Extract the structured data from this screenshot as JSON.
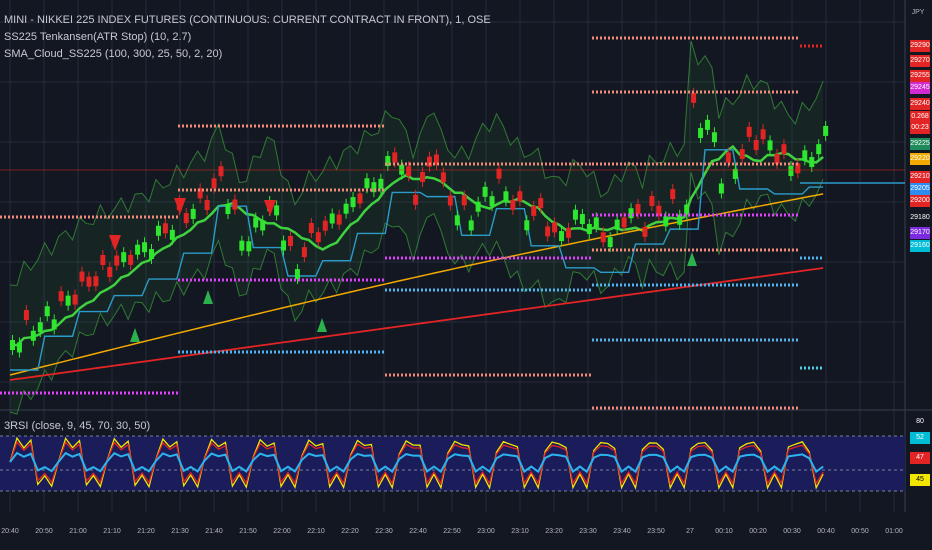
{
  "colors": {
    "background": "#131722",
    "grid": "#262b3e",
    "bull": "#2ee62e",
    "bear": "#e32424",
    "rsi_fill": "#1b1d5a",
    "ma_green": "#3fd13f",
    "ma_orange": "#f2a900",
    "ma_red": "#e32424",
    "band": "#2e8b2e"
  },
  "legend": {
    "symbol": "MINI - NIKKEI 225 INDEX FUTURES (CONTINUOUS: CURRENT CONTRACT IN FRONT), 1, OSE",
    "indicator1": "SS225 Tenkansen(ATR Stop) (10, 2.7)",
    "indicator2": "SMA_Cloud_SS225 (100, 300, 25, 50, 2, 20)",
    "indicator3": "3RSI (close, 9, 45, 70, 30, 50)"
  },
  "currency_label": "JPY",
  "price_axis_labels": [
    {
      "text": "29290",
      "color": "#e32424"
    },
    {
      "text": "29270",
      "color": "#e32424"
    },
    {
      "text": "29255",
      "color": "#e32424"
    },
    {
      "text": "29245",
      "color": "#d12ad1"
    },
    {
      "text": "29240",
      "color": "#e32424"
    },
    {
      "text": "0.268",
      "color": "#e32424"
    },
    {
      "text": "00:23",
      "color": "#e32424"
    },
    {
      "text": "29225",
      "color": "#1f8a5a"
    },
    {
      "text": "29220",
      "color": "#f2a900"
    },
    {
      "text": "29210",
      "color": "#e32424"
    },
    {
      "text": "29205",
      "color": "#2d8cf0"
    },
    {
      "text": "29200",
      "color": "#e32424"
    },
    {
      "text": "29180",
      "color": ""
    },
    {
      "text": "29170",
      "color": "#7b2ae0"
    },
    {
      "text": "29160",
      "color": "#00bcd4"
    }
  ],
  "rsi_axis_labels": [
    {
      "text": "80",
      "color": ""
    },
    {
      "text": "52",
      "color": "#00bcd4"
    },
    {
      "text": "47",
      "color": "#e32424"
    },
    {
      "text": "45",
      "color": "#f2e600"
    }
  ],
  "time_labels": [
    "20:40",
    "20:50",
    "21:00",
    "21:10",
    "21:20",
    "21:30",
    "21:40",
    "21:50",
    "22:00",
    "22:10",
    "22:20",
    "22:30",
    "22:40",
    "22:50",
    "23:00",
    "23:10",
    "23:20",
    "23:30",
    "23:40",
    "23:50",
    "27",
    "00:10",
    "00:20",
    "00:30",
    "00:40",
    "00:50",
    "01:00"
  ],
  "chart_data": {
    "type": "candlestick",
    "x_unit": "time",
    "y_unit": "price (JPY)",
    "price_levels_shown": [
      29290,
      29270,
      29255,
      29245,
      29240,
      29225,
      29220,
      29210,
      29205,
      29200,
      29180,
      29170,
      29160
    ],
    "rsi_levels_shown": [
      80,
      52,
      47,
      45
    ]
  }
}
